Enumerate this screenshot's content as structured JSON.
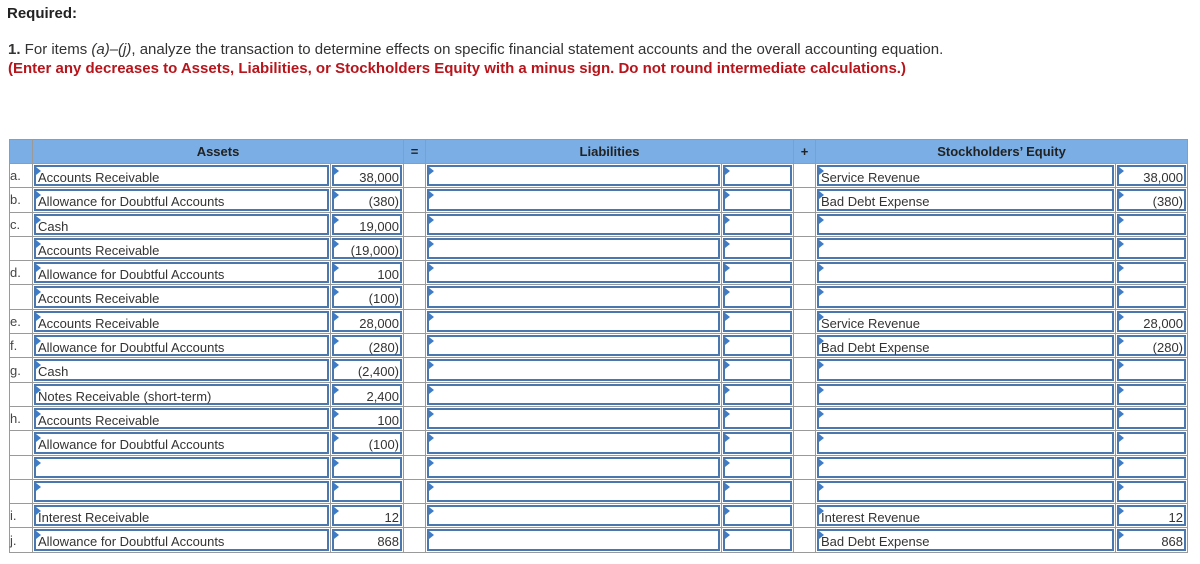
{
  "required_label": "Required:",
  "instruction": {
    "number": "1.",
    "text_part1": " For items ",
    "items_range": "(a)–(j)",
    "text_part2": ", analyze the transaction to determine effects on specific financial statement accounts and the overall accounting equation. ",
    "emphasis": "(Enter any decreases to Assets, Liabilities, or Stockholders Equity with a minus sign. Do not round intermediate calculations.)"
  },
  "table": {
    "headers": {
      "assets": "Assets",
      "equals": "=",
      "liabilities": "Liabilities",
      "plus": "+",
      "equity": "Stockholders’ Equity"
    },
    "rows": [
      {
        "letter": "a.",
        "asset_account": "Accounts Receivable",
        "asset_amount": "38,000",
        "liab_account": "",
        "liab_amount": "",
        "equity_account": "Service Revenue",
        "equity_amount": "38,000"
      },
      {
        "letter": "b.",
        "asset_account": "Allowance for Doubtful Accounts",
        "asset_amount": "(380)",
        "liab_account": "",
        "liab_amount": "",
        "equity_account": "Bad Debt Expense",
        "equity_amount": "(380)"
      },
      {
        "letter": "c.",
        "asset_account": "Cash",
        "asset_amount": "19,000",
        "liab_account": "",
        "liab_amount": "",
        "equity_account": "",
        "equity_amount": ""
      },
      {
        "letter": "",
        "asset_account": "Accounts Receivable",
        "asset_amount": "(19,000)",
        "liab_account": "",
        "liab_amount": "",
        "equity_account": "",
        "equity_amount": ""
      },
      {
        "letter": "d.",
        "asset_account": "Allowance for Doubtful Accounts",
        "asset_amount": "100",
        "liab_account": "",
        "liab_amount": "",
        "equity_account": "",
        "equity_amount": ""
      },
      {
        "letter": "",
        "asset_account": "Accounts Receivable",
        "asset_amount": "(100)",
        "liab_account": "",
        "liab_amount": "",
        "equity_account": "",
        "equity_amount": ""
      },
      {
        "letter": "e.",
        "asset_account": "Accounts Receivable",
        "asset_amount": "28,000",
        "liab_account": "",
        "liab_amount": "",
        "equity_account": "Service Revenue",
        "equity_amount": "28,000"
      },
      {
        "letter": "f.",
        "asset_account": "Allowance for Doubtful Accounts",
        "asset_amount": "(280)",
        "liab_account": "",
        "liab_amount": "",
        "equity_account": "Bad Debt Expense",
        "equity_amount": "(280)"
      },
      {
        "letter": "g.",
        "asset_account": "Cash",
        "asset_amount": "(2,400)",
        "liab_account": "",
        "liab_amount": "",
        "equity_account": "",
        "equity_amount": ""
      },
      {
        "letter": "",
        "asset_account": "Notes Receivable (short-term)",
        "asset_amount": "2,400",
        "liab_account": "",
        "liab_amount": "",
        "equity_account": "",
        "equity_amount": ""
      },
      {
        "letter": "h.",
        "asset_account": "Accounts Receivable",
        "asset_amount": "100",
        "liab_account": "",
        "liab_amount": "",
        "equity_account": "",
        "equity_amount": ""
      },
      {
        "letter": "",
        "asset_account": "Allowance for Doubtful Accounts",
        "asset_amount": "(100)",
        "liab_account": "",
        "liab_amount": "",
        "equity_account": "",
        "equity_amount": ""
      },
      {
        "letter": "",
        "asset_account": "",
        "asset_amount": "",
        "liab_account": "",
        "liab_amount": "",
        "equity_account": "",
        "equity_amount": ""
      },
      {
        "letter": "",
        "asset_account": "",
        "asset_amount": "",
        "liab_account": "",
        "liab_amount": "",
        "equity_account": "",
        "equity_amount": ""
      },
      {
        "letter": "i.",
        "asset_account": "Interest Receivable",
        "asset_amount": "12",
        "liab_account": "",
        "liab_amount": "",
        "equity_account": "Interest Revenue",
        "equity_amount": "12"
      },
      {
        "letter": "j.",
        "asset_account": "Allowance for Doubtful Accounts",
        "asset_amount": "868",
        "liab_account": "",
        "liab_amount": "",
        "equity_account": "Bad Debt Expense",
        "equity_amount": "868"
      }
    ]
  }
}
